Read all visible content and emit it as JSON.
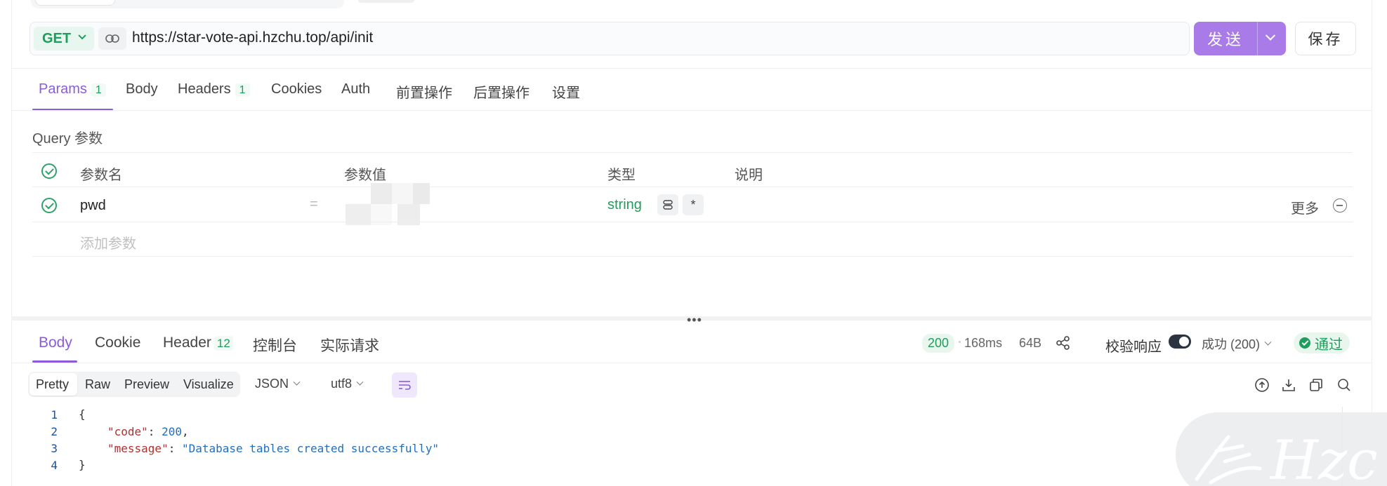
{
  "request": {
    "method": "GET",
    "url": "https://star-vote-api.hzchu.top/api/init",
    "send_label": "发送",
    "save_label": "保存"
  },
  "request_tabs": [
    {
      "label": "Params",
      "badge": "1"
    },
    {
      "label": "Body"
    },
    {
      "label": "Headers",
      "badge": "1"
    },
    {
      "label": "Cookies"
    },
    {
      "label": "Auth"
    },
    {
      "label": "前置操作"
    },
    {
      "label": "后置操作"
    },
    {
      "label": "设置"
    }
  ],
  "query": {
    "title": "Query 参数",
    "headers": [
      "参数名",
      "参数值",
      "类型",
      "说明"
    ],
    "rows": [
      {
        "name": "pwd",
        "eq": "=",
        "type": "string",
        "more": "更多"
      }
    ],
    "add_placeholder": "添加参数"
  },
  "response_tabs": [
    {
      "label": "Body"
    },
    {
      "label": "Cookie"
    },
    {
      "label": "Header",
      "badge": "12"
    },
    {
      "label": "控制台"
    },
    {
      "label": "实际请求"
    }
  ],
  "response_meta": {
    "status": "200",
    "time": "168ms",
    "size": "64B",
    "validate_label": "校验响应",
    "result_label": "成功 (200)",
    "pass_label": "通过"
  },
  "view_modes": [
    "Pretty",
    "Raw",
    "Preview",
    "Visualize"
  ],
  "format": "JSON",
  "encoding": "utf8",
  "body_lines": [
    {
      "n": "1",
      "text": "{"
    },
    {
      "n": "2",
      "key": "\"code\"",
      "value": "200",
      "trail": ","
    },
    {
      "n": "3",
      "key": "\"message\"",
      "value": "\"Database tables created successfully\"",
      "trail": ""
    },
    {
      "n": "4",
      "text": "}"
    }
  ],
  "watermark_text": "Hzc",
  "colors": {
    "accent": "#8a5cdb",
    "send_button": "#a97be8",
    "success": "#1f9d5c"
  }
}
